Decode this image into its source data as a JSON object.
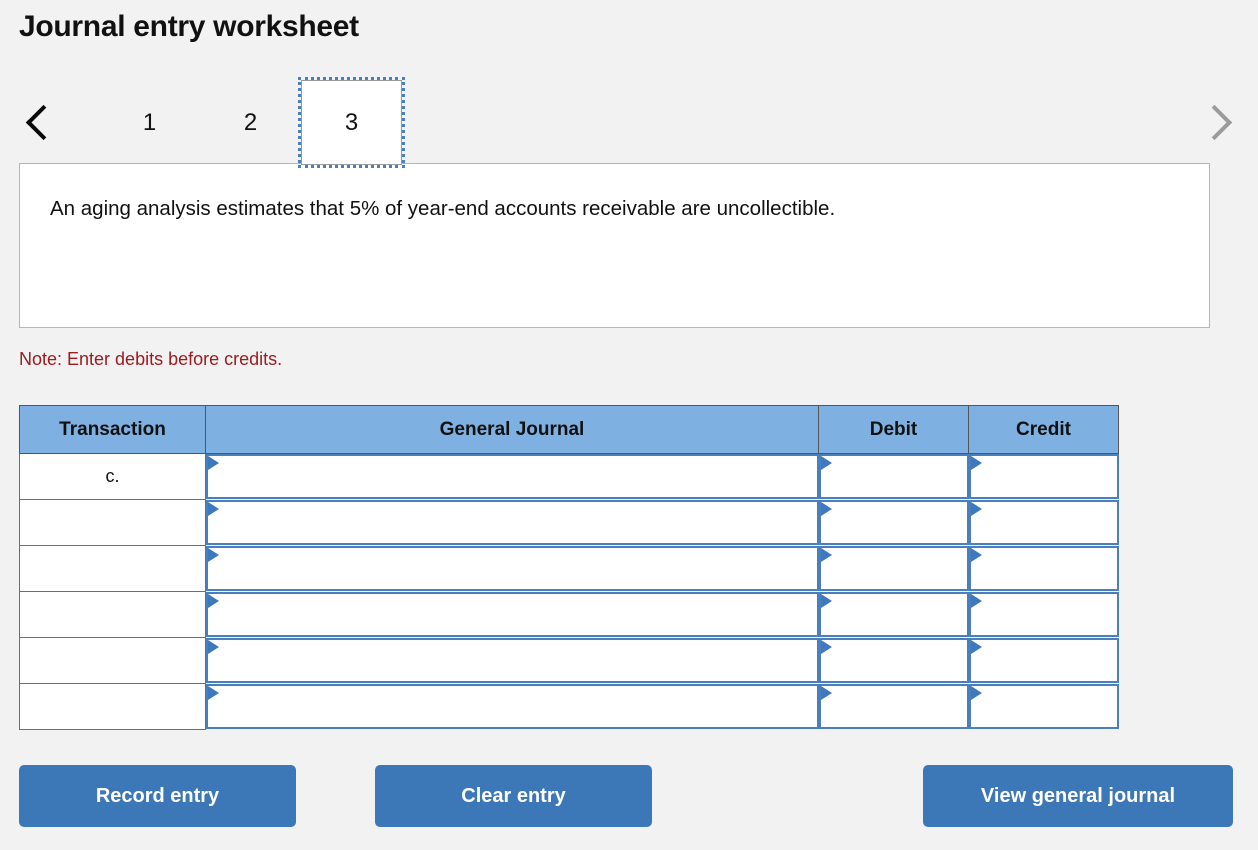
{
  "page": {
    "title": "Journal entry worksheet",
    "background_color": "#f2f2f2"
  },
  "pager": {
    "prev_icon": "chevron-left-icon",
    "next_icon": "chevron-right-icon",
    "prev_enabled": true,
    "next_enabled": false,
    "selected_index": 2,
    "tabs": [
      {
        "label": "1",
        "selected": false
      },
      {
        "label": "2",
        "selected": false
      },
      {
        "label": "3",
        "selected": true
      }
    ]
  },
  "prompt": {
    "text": "An aging analysis estimates that 5% of year-end accounts receivable are uncollectible."
  },
  "note": {
    "text": "Note: Enter debits before credits.",
    "color": "#9c1c20"
  },
  "journal_table": {
    "header_color": "#7eb0e2",
    "columns": [
      "Transaction",
      "General Journal",
      "Debit",
      "Credit"
    ],
    "rows": [
      {
        "transaction": "c.",
        "general_journal": "",
        "debit": "",
        "credit": ""
      },
      {
        "transaction": "",
        "general_journal": "",
        "debit": "",
        "credit": ""
      },
      {
        "transaction": "",
        "general_journal": "",
        "debit": "",
        "credit": ""
      },
      {
        "transaction": "",
        "general_journal": "",
        "debit": "",
        "credit": ""
      },
      {
        "transaction": "",
        "general_journal": "",
        "debit": "",
        "credit": ""
      },
      {
        "transaction": "",
        "general_journal": "",
        "debit": "",
        "credit": ""
      }
    ]
  },
  "buttons": {
    "record": "Record entry",
    "clear": "Clear entry",
    "view": "View general journal",
    "color": "#3c77b8"
  }
}
